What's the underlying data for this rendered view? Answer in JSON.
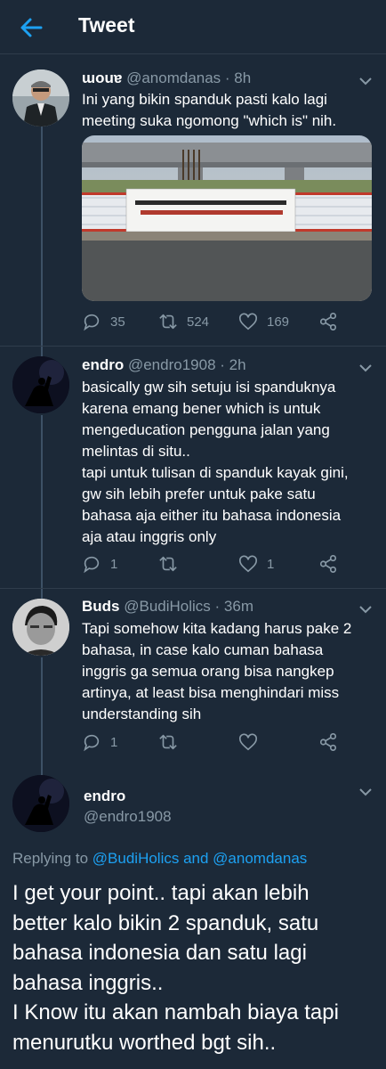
{
  "header": {
    "title": "Tweet"
  },
  "tweets": [
    {
      "name": "ɯouɐ",
      "handle": "@anomdanas",
      "time": "· 8h",
      "lines": [
        "Ini yang bikin spanduk pasti kalo lagi",
        "meeting suka ngomong \"which is\" nih."
      ],
      "media": {
        "banner_lines": [
          "SIAPAPUN ANDA BILA MELIHAT UNSAFE CONDITION ATAU UNSAFE ACTION,",
          "SEGERA LAKUKAN SWA (STOP WORKING AUTHORITY) STOP PEKERJAAN!!"
        ]
      },
      "replies": "35",
      "retweets": "524",
      "likes": "169"
    },
    {
      "name": "endro",
      "handle": "@endro1908",
      "time": "· 2h",
      "lines": [
        "basically gw sih setuju  isi spanduknya",
        "karena emang bener which is untuk",
        "mengeducation pengguna jalan yang",
        "melintas di situ..",
        "tapi untuk tulisan di spanduk kayak gini,",
        "gw sih lebih prefer untuk pake satu",
        "bahasa aja either itu bahasa indonesia",
        "aja atau inggris only"
      ],
      "replies": "1",
      "retweets": "",
      "likes": "1"
    },
    {
      "name": "Buds",
      "handle": "@BudiHolics",
      "time": "· 36m",
      "lines": [
        "Tapi somehow kita kadang harus pake 2",
        "bahasa, in case kalo cuman bahasa",
        "inggris ga semua orang bisa nangkep",
        "artinya, at least bisa menghindari miss",
        "understanding sih"
      ],
      "replies": "1",
      "retweets": "",
      "likes": ""
    }
  ],
  "main": {
    "name": "endro",
    "handle": "@endro1908",
    "replying_prefix": "Replying to",
    "replying_users": "@BudiHolics and @anomdanas",
    "lines": [
      "I get your point.. tapi akan lebih",
      "better kalo bikin 2 spanduk, satu",
      "bahasa indonesia dan satu lagi",
      "bahasa inggris..",
      "I Know itu akan nambah biaya tapi",
      "menurutku worthed bgt sih.."
    ]
  },
  "colors": {
    "background": "#1c2938",
    "accent": "#1da1f2",
    "secondary_text": "#8899a6",
    "divider": "#2f3d4c"
  }
}
